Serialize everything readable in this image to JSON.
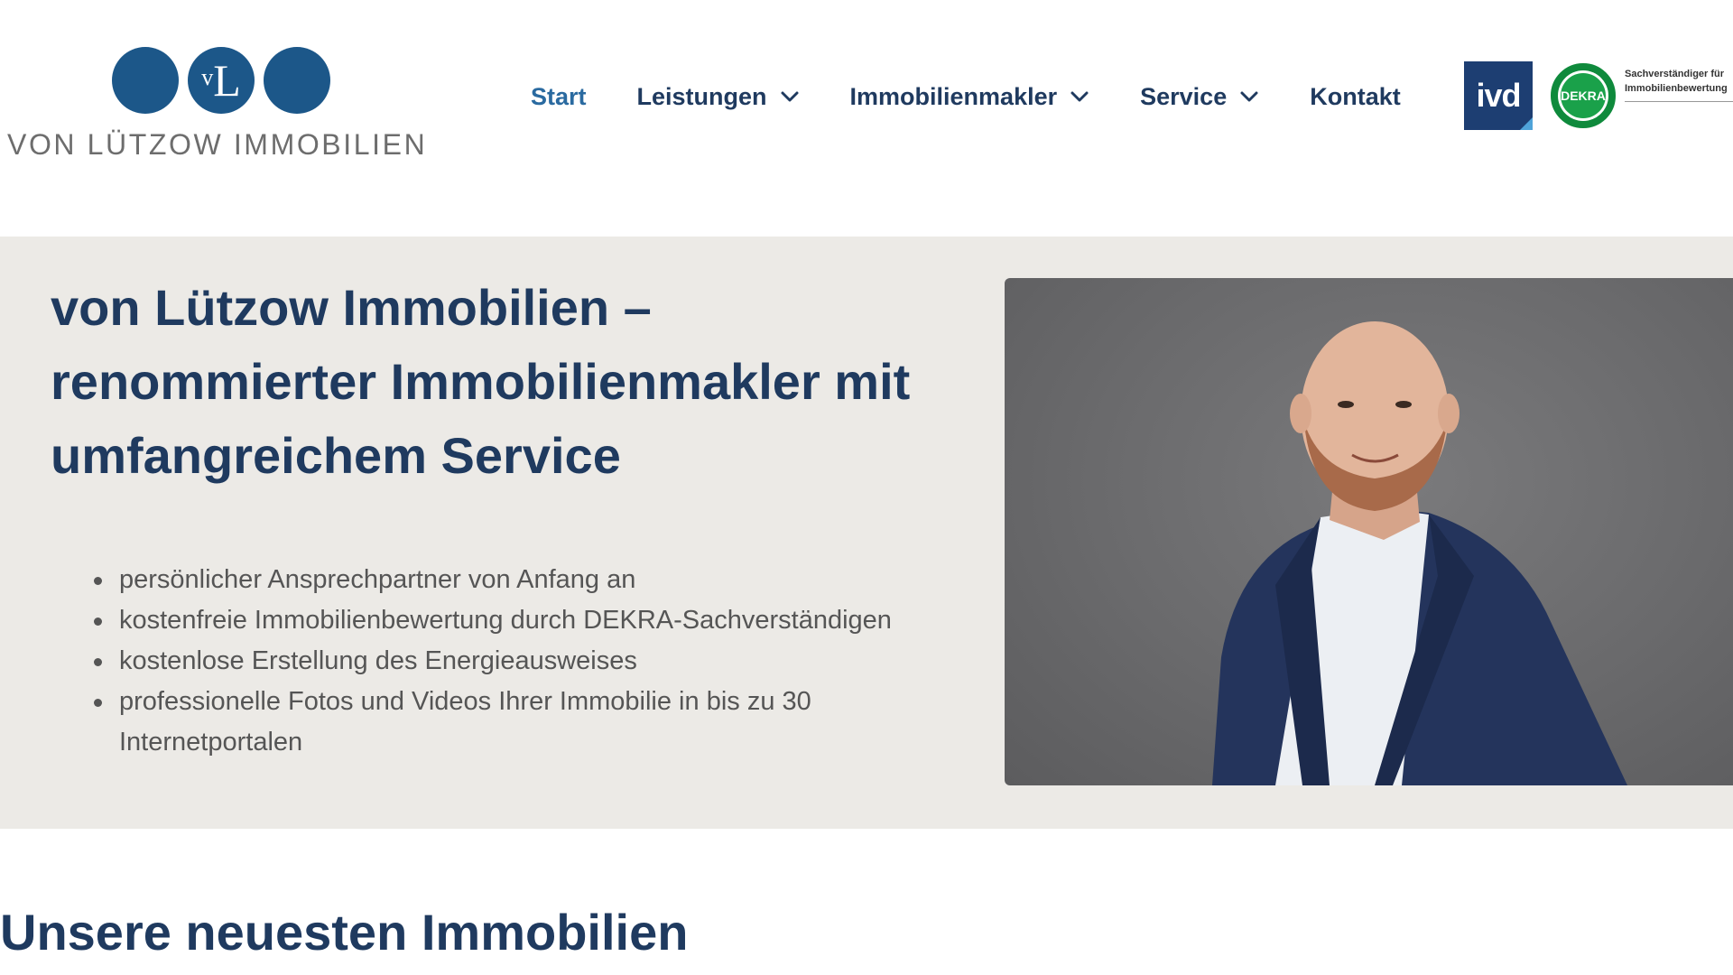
{
  "header": {
    "logo": {
      "monogram_small": "v",
      "monogram_large": "L",
      "text": "VON LÜTZOW IMMOBILIEN"
    },
    "nav": [
      {
        "label": "Start",
        "active": true,
        "dropdown": false
      },
      {
        "label": "Leistungen",
        "active": false,
        "dropdown": true
      },
      {
        "label": "Immobilienmakler",
        "active": false,
        "dropdown": true
      },
      {
        "label": "Service",
        "active": false,
        "dropdown": true
      },
      {
        "label": "Kontakt",
        "active": false,
        "dropdown": false
      }
    ],
    "badges": {
      "ivd": "ivd",
      "dekra_seal": "DEKRA",
      "dekra_text": "Sachverständiger für Immobilienbewertung"
    }
  },
  "hero": {
    "title": "von Lützow Immobilien – renommierter Immobilienmakler mit umfangreichem Service",
    "bullets": [
      "persönlicher Ansprechpartner von Anfang an",
      "kostenfreie Immobilienbewertung durch DEKRA-Sachverständigen",
      "kostenlose Erstellung des Energieausweises",
      "professionelle Fotos und Videos Ihrer Immobilie in bis zu 30 Internetportalen"
    ]
  },
  "sections": {
    "latest_title": "Unsere neuesten Immobilien"
  },
  "colors": {
    "brand_blue": "#1c5789",
    "nav_text": "#1f3a5f",
    "nav_active": "#2a6aa0",
    "hero_bg": "#eceae6",
    "body_text": "#555555"
  }
}
